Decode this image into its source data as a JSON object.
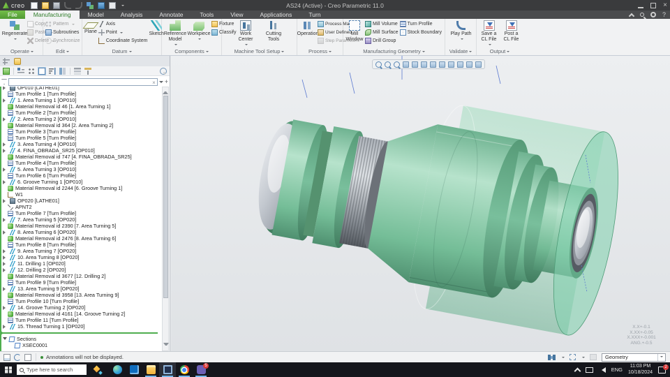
{
  "window": {
    "brand": "creo",
    "title": "AS24 (Active) - Creo Parametric 11.0",
    "close_glyph": "×",
    "help_glyph": "?"
  },
  "tabs": [
    {
      "label": "File"
    },
    {
      "label": "Manufacturing"
    },
    {
      "label": "Model"
    },
    {
      "label": "Analysis"
    },
    {
      "label": "Annotate"
    },
    {
      "label": "Tools"
    },
    {
      "label": "View"
    },
    {
      "label": "Applications"
    },
    {
      "label": "Turn"
    }
  ],
  "ribbon": {
    "operate": {
      "label": "Operate",
      "regenerate": "Regenerate",
      "copy": "Copy",
      "paste": "Paste",
      "delete": "Delete"
    },
    "edit": {
      "label": "Edit",
      "pattern": "Pattern",
      "subroutines": "Subroutines",
      "synchronize": "Synchronize"
    },
    "datum": {
      "label": "Datum",
      "plane": "Plane",
      "axis": "Axis",
      "point": "Point",
      "csys": "Coordinate System",
      "sketch": "Sketch"
    },
    "components": {
      "label": "Components",
      "reference_model": "Reference Model",
      "workpiece": "Workpiece",
      "fixture": "Fixture",
      "classify": "Classify"
    },
    "machine_tool": {
      "label": "Machine Tool Setup",
      "work_center": "Work Center",
      "cutting_tools": "Cutting Tools"
    },
    "process": {
      "label": "Process",
      "operation": "Operation",
      "process_manager": "Process Manager",
      "user_defined": "User Defined",
      "step_parameters": "Step Parameters"
    },
    "mfg_geometry": {
      "label": "Manufacturing Geometry",
      "mill_window": "Mill Window",
      "mill_volume": "Mill Volume",
      "mill_surface": "Mill Surface",
      "drill_group": "Drill Group",
      "turn_profile": "Turn Profile",
      "stock_boundary": "Stock Boundary"
    },
    "validate": {
      "label": "Validate",
      "play_path": "Play Path"
    },
    "output": {
      "label": "Output",
      "save_cl": "Save a CL File",
      "post_cl": "Post a CL File"
    }
  },
  "tree": {
    "filter_value": "",
    "items": [
      {
        "l": "OP010 [LATHE01]",
        "i": "op",
        "a": true
      },
      {
        "l": "Turn Profile 1 [Turn Profile]",
        "i": "profile"
      },
      {
        "l": "1. Area Turning 1 [OP010]",
        "i": "step",
        "a": true
      },
      {
        "l": "Material Removal id 46 [1. Area Turning 1]",
        "i": "removal"
      },
      {
        "l": "Turn Profile 2 [Turn Profile]",
        "i": "profile"
      },
      {
        "l": "2. Area Turning 2 [OP010]",
        "i": "step",
        "a": true
      },
      {
        "l": "Material Removal id 364 [2. Area Turning 2]",
        "i": "removal"
      },
      {
        "l": "Turn Profile 3 [Turn Profile]",
        "i": "profile"
      },
      {
        "l": "Turn Profile 5 [Turn Profile]",
        "i": "profile"
      },
      {
        "l": "3. Area Turning 4 [OP010]",
        "i": "step",
        "a": true
      },
      {
        "l": "4. FINA_OBRADA_SR25 [OP010]",
        "i": "step",
        "a": true
      },
      {
        "l": "Material Removal id 747 [4. FINA_OBRADA_SR25]",
        "i": "removal"
      },
      {
        "l": "Turn Profile 4 [Turn Profile]",
        "i": "profile"
      },
      {
        "l": "5. Area Turning 3 [OP010]",
        "i": "step",
        "a": true
      },
      {
        "l": "Turn Profile 6 [Turn Profile]",
        "i": "profile"
      },
      {
        "l": "6. Groove Turning 1 [OP010]",
        "i": "step",
        "a": true
      },
      {
        "l": "Material Removal id 2244 [6. Groove Turning 1]",
        "i": "removal"
      },
      {
        "l": "W1",
        "i": "csys"
      },
      {
        "l": "OP020 [LATHE01]",
        "i": "op",
        "a": true
      },
      {
        "l": "APNT2",
        "i": "point"
      },
      {
        "l": "Turn Profile 7 [Turn Profile]",
        "i": "profile"
      },
      {
        "l": "7. Area Turning 5 [OP020]",
        "i": "step",
        "a": true
      },
      {
        "l": "Material Removal id 2390 [7. Area Turning 5]",
        "i": "removal"
      },
      {
        "l": "8. Area Turning 6 [OP020]",
        "i": "step",
        "a": true
      },
      {
        "l": "Material Removal id 2476 [8. Area Turning 6]",
        "i": "removal"
      },
      {
        "l": "Turn Profile 8 [Turn Profile]",
        "i": "profile"
      },
      {
        "l": "9. Area Turning 7 [OP020]",
        "i": "step",
        "a": true
      },
      {
        "l": "10. Area Turning 8 [OP020]",
        "i": "step",
        "a": true
      },
      {
        "l": "11. Drilling 1 [OP020]",
        "i": "step",
        "a": true
      },
      {
        "l": "12. Drilling 2 [OP020]",
        "i": "step",
        "a": true
      },
      {
        "l": "Material Removal id 3677 [12. Drilling 2]",
        "i": "removal"
      },
      {
        "l": "Turn Profile 9 [Turn Profile]",
        "i": "profile"
      },
      {
        "l": "13. Area Turning 9 [OP020]",
        "i": "step",
        "a": true
      },
      {
        "l": "Material Removal id 3958 [13. Area Turning 9]",
        "i": "removal"
      },
      {
        "l": "Turn Profile 10 [Turn Profile]",
        "i": "profile"
      },
      {
        "l": "14. Groove Turning 2 [OP020]",
        "i": "step",
        "a": true
      },
      {
        "l": "Material Removal id 4161 [14. Groove Turning 2]",
        "i": "removal"
      },
      {
        "l": "Turn Profile 11 [Turn Profile]",
        "i": "profile"
      },
      {
        "l": "15. Thread Turning 1 [OP020]",
        "i": "step",
        "a": true
      },
      {
        "sep": true
      },
      {
        "l": "Sections",
        "i": "folder",
        "a": true,
        "open": true
      },
      {
        "l": "XSEC0001",
        "i": "folder",
        "indent": 1
      }
    ]
  },
  "viewport": {
    "toolbar_icons": [
      "refit",
      "zoom-in",
      "zoom-out",
      "repaint",
      "shaded",
      "saved-views",
      "view-manager",
      "capture",
      "datum-display",
      "annotation-display",
      "spin-center",
      "dragger"
    ],
    "tolerances": [
      "X.X+-0.1",
      "X.XX+-0.05",
      "X.XXX+-0.001",
      "ANG.+-0.5"
    ]
  },
  "statusbar": {
    "message": "Annotations will not be displayed.",
    "selection_filter": "Geometry"
  },
  "taskbar": {
    "search_placeholder": "Type here to search",
    "apps": [
      {
        "name": "edge",
        "running": false
      },
      {
        "name": "outlook",
        "running": false
      },
      {
        "name": "file-explorer",
        "running": true
      },
      {
        "name": "creo",
        "running": true,
        "active": true
      },
      {
        "name": "chrome",
        "running": true
      },
      {
        "name": "chat",
        "running": true,
        "badge": "5"
      }
    ],
    "language": "ENG",
    "time": "11:03 PM",
    "date": "10/18/2024",
    "notification_count": "2"
  }
}
